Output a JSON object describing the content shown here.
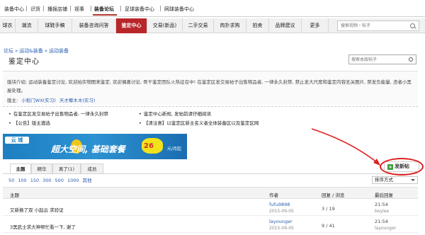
{
  "top_nav": {
    "items": [
      "装备中心",
      "识货",
      "播报店铺",
      "视事",
      "装备论坛",
      "足球装备中心",
      "网球装备中心"
    ]
  },
  "main_nav": {
    "tabs": [
      "球衣",
      "潮流",
      "球鞋手稿",
      "装备咨询问答",
      "鉴定中心",
      "交易(新品)",
      "二手交易",
      "肉扑求购",
      "拍卖",
      "品牌建议",
      "更多"
    ],
    "active_index": 4,
    "search_placeholder": "搜索视频・帖子"
  },
  "breadcrumb": [
    "论坛",
    "运动&装备",
    "运动装备"
  ],
  "forum": {
    "title": "鉴定中心",
    "search_placeholder": "搜索本版帖子"
  },
  "info": {
    "description": "版块介绍: 运动装备鉴定讨论, 欢迎拍实物图来鉴定, 欢迎偶喜讨论, 骨干鉴定团队火热征召中! 在鉴定区发交易帖子出售物品者, 一律永久封禁, 禁止发大尺度和鉴定内容无关图片, 禁发负能量, 违者小黑屋处理。",
    "moderators_label": "版主:",
    "moderators": [
      "小稻门WX(实习)",
      "天才椰木木(实习)"
    ]
  },
  "rules": [
    "在鉴定区发交易帖子出售物品者, 一律永久封禁",
    "鉴定中心新规, 发帖前请仔细阅读",
    "【公告】版主遴选",
    "【清注意】以鉴定区新主名义者全体装备区以及鉴定区网"
  ],
  "banner": {
    "logo": "云 城",
    "headline": "超大空间, 基础套餐",
    "price": "26",
    "unit": "元/月起"
  },
  "tabs": [
    "主题",
    "精华",
    "离了(1)",
    "成员"
  ],
  "active_tab": 0,
  "new_post_label": "发新帖",
  "page_sizes": [
    "50",
    "100",
    "150",
    "300",
    "500",
    "1000",
    "其他"
  ],
  "sort_label": "排序方式",
  "table": {
    "headers": [
      "主题",
      "作者",
      "回复 / 浏览",
      "最后回复"
    ],
    "rows": [
      {
        "title": "又新换了双 小起云 求验证",
        "author": "fufu9898",
        "date": "2015-09-05",
        "stats": "3 / 19",
        "last_time": "21:54",
        "last_user": "boylee"
      },
      {
        "title": "3黑武士求大神帮忙看一下, 谢了",
        "author": "layounger",
        "date": "2015-09-05",
        "stats": "9 / 41",
        "last_time": "21:54",
        "last_user": "layounger"
      }
    ]
  },
  "colors": {
    "accent": "#b8262a",
    "link": "#2a5db0",
    "annotation": "#e02020"
  }
}
